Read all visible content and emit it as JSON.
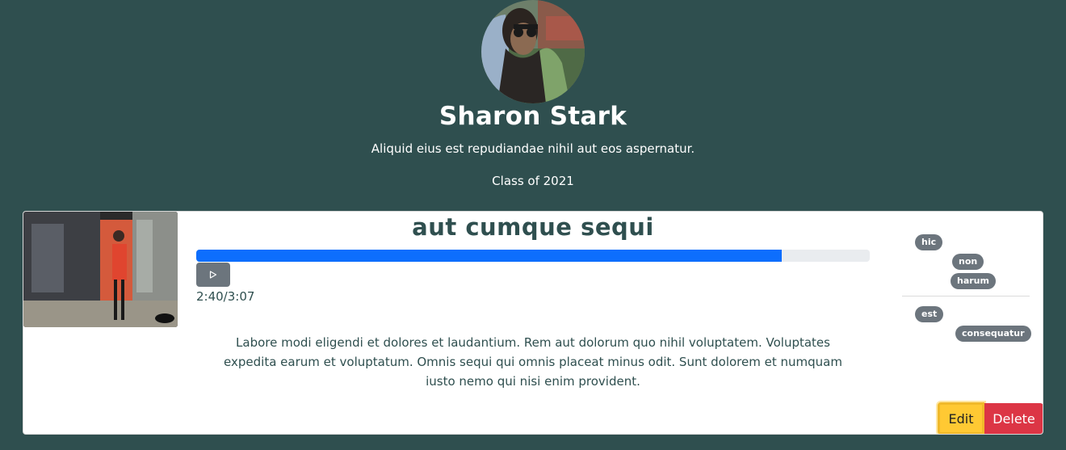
{
  "profile": {
    "name": "Sharon Stark",
    "bio": "Aliquid eius est repudiandae nihil aut eos aspernatur.",
    "class_year": "Class of 2021"
  },
  "track": {
    "title": "aut cumque sequi",
    "progress_fraction": 0.869,
    "time": "2:40/3:07",
    "description": "Labore modi eligendi et dolores et laudantium. Rem aut dolorum quo nihil voluptatem. Voluptates expedita earum et voluptatum. Omnis sequi qui omnis placeat minus odit. Sunt dolorem et numquam iusto nemo qui nisi enim provident.",
    "play_icon": "play-icon"
  },
  "tags": {
    "group1": [
      "hic",
      "non",
      "harum"
    ],
    "group2": [
      "est",
      "consequatur"
    ]
  },
  "actions": {
    "edit_label": "Edit",
    "delete_label": "Delete"
  },
  "colors": {
    "background": "#2f4f4f",
    "progress": "#0d6efd",
    "edit": "#ffc933",
    "delete": "#dc3545",
    "tag": "#6c757d"
  }
}
